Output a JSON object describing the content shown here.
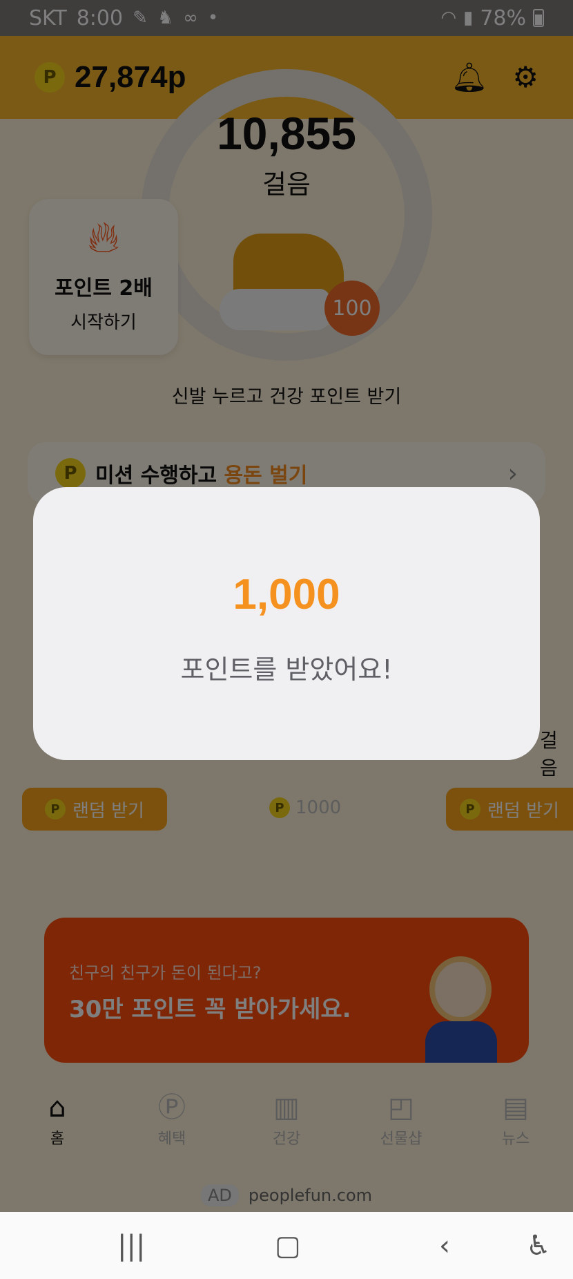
{
  "status_bar": {
    "carrier": "SKT",
    "time": "8:00",
    "battery": "78%"
  },
  "header": {
    "points": "27,874p",
    "coin_symbol": "P"
  },
  "steps": {
    "count": "10,855",
    "unit": "걸음"
  },
  "double_card": {
    "title": "포인트 2배",
    "subtitle": "시작하기"
  },
  "shoe_badge": "100",
  "shoe_hint": "신발 누르고 건강 포인트 받기",
  "mission": {
    "text_a": "미션 수행하고 ",
    "text_b": "용돈 벌기"
  },
  "rewards": {
    "random_label": "랜덤 받기",
    "middle_value": "1000",
    "edge_text": "걸음"
  },
  "banner": {
    "line1": "친구의 친구가 돈이 된다고?",
    "line2": "30만 포인트 꼭 받아가세요."
  },
  "tabs": [
    {
      "label": "홈",
      "icon": "home-icon"
    },
    {
      "label": "혜택",
      "icon": "points-icon"
    },
    {
      "label": "건강",
      "icon": "chart-icon"
    },
    {
      "label": "선물샵",
      "icon": "shopping-bag-icon"
    },
    {
      "label": "뉴스",
      "icon": "news-icon"
    }
  ],
  "ad": {
    "badge": "AD",
    "domain": "peoplefun.com"
  },
  "modal": {
    "amount": "1,000",
    "message": "포인트를 받았어요!"
  },
  "colors": {
    "accent": "#f5911e",
    "header_bg": "#f6b42a",
    "banner_bg": "#ff4c0c"
  }
}
